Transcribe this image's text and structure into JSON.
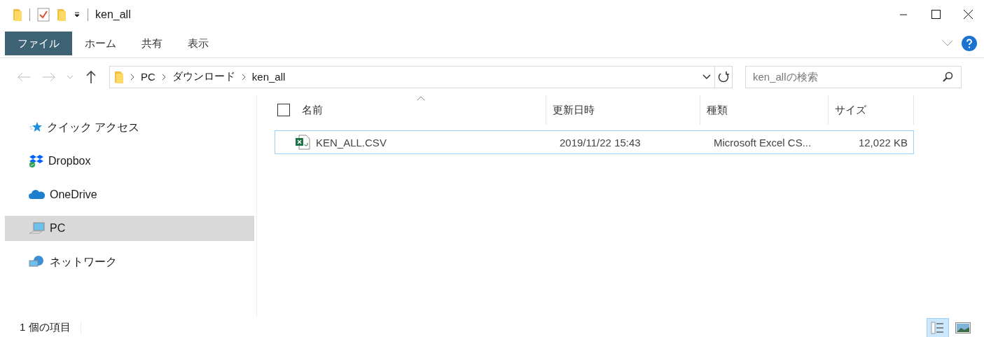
{
  "window": {
    "title": "ken_all"
  },
  "ribbon_tabs": [
    {
      "label": "ファイル",
      "selected": true
    },
    {
      "label": "ホーム",
      "selected": false
    },
    {
      "label": "共有",
      "selected": false
    },
    {
      "label": "表示",
      "selected": false
    }
  ],
  "address": {
    "breadcrumbs": [
      "PC",
      "ダウンロード",
      "ken_all"
    ]
  },
  "search": {
    "placeholder": "ken_allの検索"
  },
  "sidebar": {
    "items": [
      {
        "label": "クイック アクセス",
        "selected": false
      },
      {
        "label": "Dropbox",
        "selected": false
      },
      {
        "label": "OneDrive",
        "selected": false
      },
      {
        "label": "PC",
        "selected": true
      },
      {
        "label": "ネットワーク",
        "selected": false
      }
    ]
  },
  "table": {
    "select_all_checked": false,
    "columns": [
      {
        "label": "名前",
        "sorted": true
      },
      {
        "label": "更新日時",
        "sorted": false
      },
      {
        "label": "種類",
        "sorted": false
      },
      {
        "label": "サイズ",
        "sorted": false
      }
    ],
    "rows": [
      {
        "name": "KEN_ALL.CSV",
        "modified": "2019/11/22 15:43",
        "type": "Microsoft Excel CS...",
        "size": "12,022 KB"
      }
    ]
  },
  "status_bar": {
    "count": "1 個の項目",
    "views": [
      {
        "selected": true
      },
      {
        "selected": false
      }
    ]
  }
}
